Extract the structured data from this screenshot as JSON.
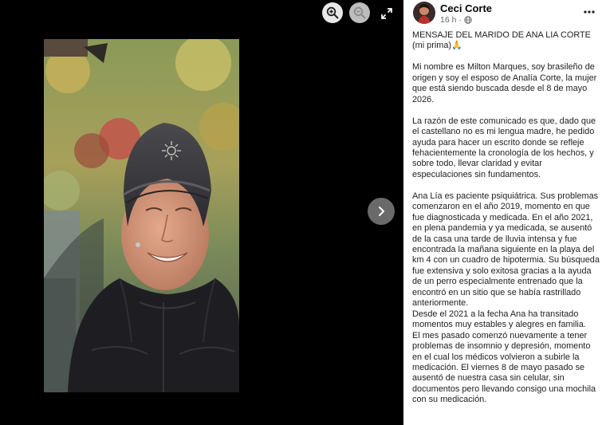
{
  "viewer": {
    "zoom_in_icon": "magnifier-plus",
    "zoom_out_icon": "magnifier-minus",
    "expand_icon": "expand-arrows",
    "next_icon": "chevron-right"
  },
  "post": {
    "author": "Ceci Corte",
    "time": "16 h",
    "separator": "·",
    "paragraphs": [
      "MENSAJE DEL MARIDO DE ANA LIA CORTE (mi prima)🙏",
      "Mi nombre es Milton Marques, soy brasileño de origen y soy el esposo de Analía Corte, la mujer que está siendo buscada desde el 8 de mayo 2026.",
      "La razón de este comunicado es que, dado que el castellano no es mi lengua madre, he pedido ayuda para hacer un escrito donde se refleje fehacientemente la cronología de los hechos, y sobre todo, llevar claridad y evitar especulaciones sin fundamentos.",
      "Ana Lía es paciente psiquiátrica. Sus problemas comenzaron en el año 2019, momento en que fue diagnosticada y medicada. En el año 2021, en plena pandemia y ya medicada, se ausentó de la casa una tarde de lluvia intensa y fue encontrada la mañana siguiente en la playa del km 4 con un cuadro de hipotermia. Su búsqueda fue extensiva y solo exitosa gracias a la ayuda de un perro especialmente entrenado que la encontró en un sitio que se había rastrillado anteriormente.",
      "Desde el 2021 a la fecha Ana ha transitado momentos muy estables y alegres en familia.",
      "El mes pasado comenzó nuevamente a tener problemas de insomnio y depresión, momento en el cual los médicos volvieron a subirle la medicación. El viernes 8 de mayo pasado se ausentó de nuestra casa sin celular, sin documentos pero llevando consigo una mochila con su medicación."
    ]
  }
}
